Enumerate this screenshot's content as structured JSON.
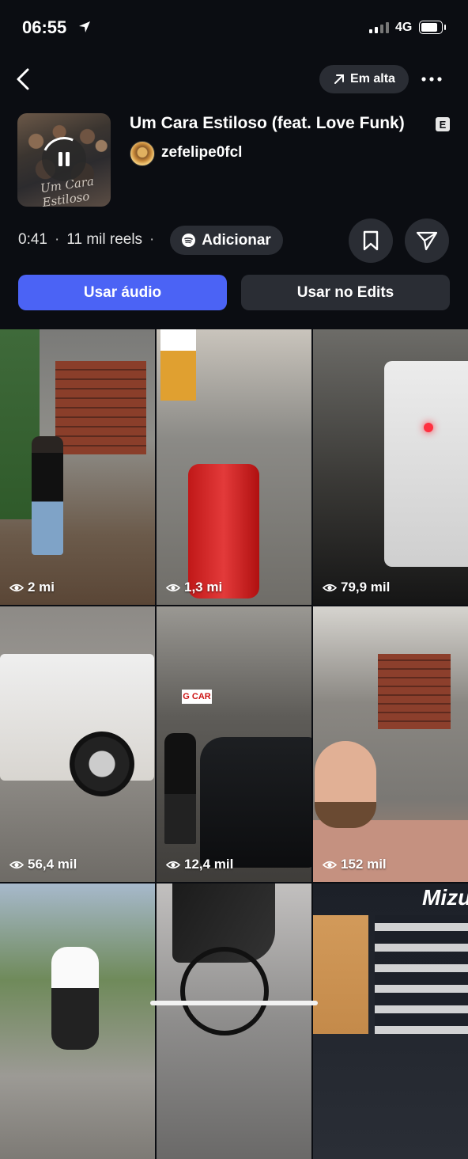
{
  "status_bar": {
    "time": "06:55",
    "network": "4G",
    "battery_level": 0.85
  },
  "header": {
    "trending_label": "Em alta"
  },
  "track": {
    "title": "Um Cara Estiloso (feat. Love Funk)",
    "explicit_badge": "E",
    "artist": "zefelipe0fcl",
    "cover_text": "Um Cara Estiloso"
  },
  "meta": {
    "duration": "0:41",
    "reels_count": "11 mil reels",
    "add_label": "Adicionar"
  },
  "actions": {
    "use_audio": "Usar áudio",
    "use_in_edits": "Usar no Edits"
  },
  "reels": [
    {
      "views": "2 mi"
    },
    {
      "views": "1,3 mi"
    },
    {
      "views": "79,9 mil"
    },
    {
      "views": "56,4 mil"
    },
    {
      "views": "12,4 mil"
    },
    {
      "views": "152 mil"
    },
    {
      "views": ""
    },
    {
      "views": ""
    },
    {
      "views": ""
    }
  ],
  "tile_texts": {
    "garage_sign": "G CAR",
    "store_brand": "Mizu"
  },
  "colors": {
    "background": "#0b0d12",
    "accent": "#4b63f5",
    "pill": "#2a2d34"
  }
}
